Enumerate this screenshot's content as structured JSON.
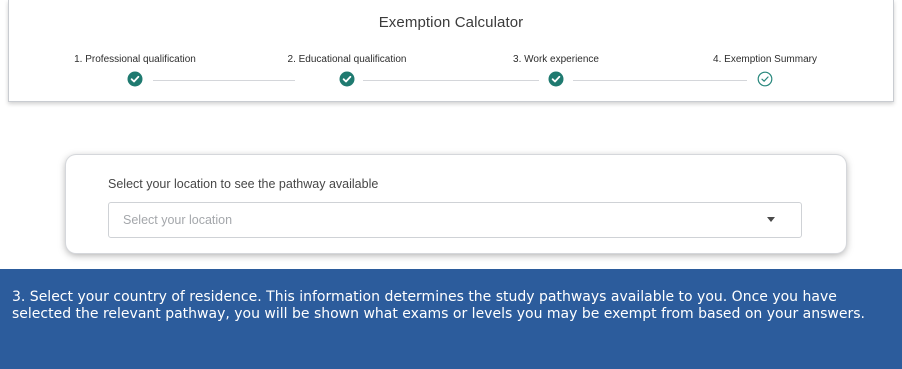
{
  "calculator": {
    "title": "Exemption Calculator",
    "steps": [
      {
        "label": "1. Professional qualification",
        "status": "complete"
      },
      {
        "label": "2. Educational qualification",
        "status": "complete"
      },
      {
        "label": "3. Work experience",
        "status": "complete"
      },
      {
        "label": "4. Exemption Summary",
        "status": "current"
      }
    ]
  },
  "location": {
    "heading": "Select your location to see the pathway available",
    "placeholder": "Select your location"
  },
  "caption": {
    "text": "3. Select your country of residence. This information determines the study pathways available to you. Once you have selected the relevant pathway, you will be shown what exams or levels you may be exempt from based on your answers."
  },
  "colors": {
    "step_complete": "#1f7a70",
    "caption_background": "#2c5c9c"
  }
}
